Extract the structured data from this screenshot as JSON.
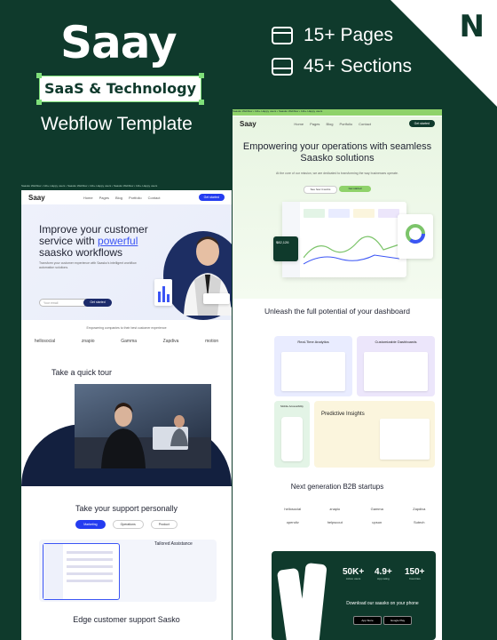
{
  "promo": {
    "logo": "Saay",
    "badge": "SaaS & Technology",
    "subtitle": "Webflow Template",
    "stats": [
      {
        "icon": "browser-window-icon",
        "text": "15+ Pages"
      },
      {
        "icon": "layout-sections-icon",
        "text": "45+ Sections"
      }
    ],
    "corner_mark": "N"
  },
  "left_preview": {
    "ticker": "Saasko Webflow • 12k+ Happy users • Saasko Webflow • 12k+ Happy users • Saasko Webflow • 12k+ Happy users",
    "nav": {
      "logo": "Saay",
      "links": [
        "Home",
        "Pages",
        "Blog",
        "Portfolio",
        "Contact"
      ],
      "cta": "Get started"
    },
    "hero_title_1": "Improve your customer service with ",
    "hero_title_hl": "powerful",
    "hero_title_2": " saasko workflows",
    "hero_desc": "Transform your customer experience with Saasko's intelligent workflow automation solutions.",
    "email_placeholder": "Your email",
    "hero_button": "Get started",
    "logos_caption": "Empowering companies to their best customer experience",
    "brands": [
      "hellosocial",
      "znapio",
      "Gamma",
      "Zapdiva",
      "motion"
    ],
    "tour_title": "Take a quick tour",
    "support_title": "Take your support personally",
    "tabs": [
      "Marketing",
      "Operations",
      "Product"
    ],
    "tailored": "Tailored Assistance",
    "edge_title": "Edge customer support Sasko"
  },
  "right_preview": {
    "ticker": "Saasko Webflow • 12k+ Happy users • Saasko Webflow • 12k+ Happy users",
    "nav": {
      "logo": "Saay",
      "links": [
        "Home",
        "Pages",
        "Blog",
        "Portfolio",
        "Contact"
      ],
      "cta": "Get started"
    },
    "hero_title": "Empowering your operations with seamless Saasko solutions",
    "hero_sub": "At the core of our mission, we are dedicated to transforming the way businesses operate.",
    "btn_primary": "See how it works",
    "btn_secondary": "Get started",
    "dash_stat": "$82,126",
    "unleash": "Unleash the full potential of your dashboard",
    "features": [
      "Real-Time Analytics",
      "Customizable Dashboards",
      "Mobile Accessibility",
      "Predictive Insights"
    ],
    "nextgen": "Next generation B2B startups",
    "brands": [
      "hellosocial",
      "znapio",
      "Gamma",
      "Zapdiva",
      "opendiv",
      "helpscout",
      "upsun",
      "Sutech"
    ],
    "cta_stats": [
      {
        "value": "50K+",
        "label": "Active users"
      },
      {
        "value": "4.9+",
        "label": "App rating"
      },
      {
        "value": "150+",
        "label": "Countries"
      }
    ],
    "cta_text": "Download our saasko on your phone",
    "stores": [
      "App Store",
      "Google Play"
    ]
  }
}
